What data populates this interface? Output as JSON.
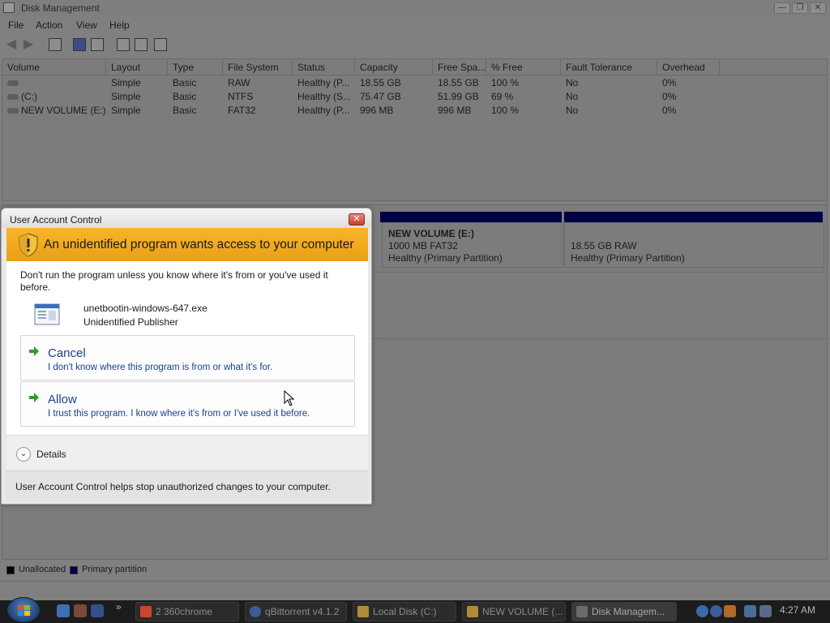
{
  "dm_window": {
    "title": "Disk Management",
    "menu": [
      "File",
      "Action",
      "View",
      "Help"
    ],
    "toolbar_icons": [
      "back-arrow-icon",
      "forward-arrow-icon",
      "console-icon",
      "help-icon",
      "console-icon",
      "refresh-icon",
      "properties-icon",
      "disk-icon"
    ],
    "columns": [
      "Volume",
      "Layout",
      "Type",
      "File System",
      "Status",
      "Capacity",
      "Free Spa...",
      "% Free",
      "Fault Tolerance",
      "Overhead"
    ],
    "rows": [
      [
        "",
        "Simple",
        "Basic",
        "RAW",
        "Healthy (P...",
        "18.55 GB",
        "18.55 GB",
        "100 %",
        "No",
        "0%"
      ],
      [
        "(C:)",
        "Simple",
        "Basic",
        "NTFS",
        "Healthy (S...",
        "75.47 GB",
        "51.99 GB",
        "69 %",
        "No",
        "0%"
      ],
      [
        "NEW VOLUME (E:)",
        "Simple",
        "Basic",
        "FAT32",
        "Healthy (P...",
        "996 MB",
        "996 MB",
        "100 %",
        "No",
        "0%"
      ]
    ],
    "partitions": [
      {
        "name": "NEW VOLUME  (E:)",
        "size": "1000 MB FAT32",
        "status": "Healthy (Primary Partition)"
      },
      {
        "name": "",
        "size": "18.55 GB RAW",
        "status": "Healthy (Primary Partition)"
      }
    ],
    "legend": {
      "unallocated": "Unallocated",
      "primary": "Primary partition"
    }
  },
  "uac": {
    "title": "User Account Control",
    "headline": "An unidentified program wants access to your computer",
    "warning": "Don't run the program unless you know where it's from or you've used it before.",
    "program_name": "unetbootin-windows-647.exe",
    "publisher": "Unidentified Publisher",
    "cancel": {
      "label": "Cancel",
      "sub": "I don't know where this program is from or what it's for."
    },
    "allow": {
      "label": "Allow",
      "sub": "I trust this program. I know where it's from or I've used it before."
    },
    "details": "Details",
    "footer": "User Account Control helps stop unauthorized changes to your computer.",
    "colors": {
      "banner": "#f0a820",
      "link_blue": "#1d3f8f",
      "arrow_green": "#2e9e2e"
    }
  },
  "taskbar": {
    "quicklaunch_icons": [
      "browser-icon",
      "network-icon",
      "desktop-icon"
    ],
    "buttons": [
      {
        "label": "2 360chrome",
        "icon": "chrome-icon"
      },
      {
        "label": "qBittorrent v4.1.2",
        "icon": "qbittorrent-icon"
      },
      {
        "label": "Local Disk (C:)",
        "icon": "folder-icon"
      },
      {
        "label": "NEW VOLUME (...",
        "icon": "folder-icon"
      },
      {
        "label": "Disk Managem...",
        "icon": "disk-management-icon"
      }
    ],
    "clock": "4:27 AM"
  }
}
